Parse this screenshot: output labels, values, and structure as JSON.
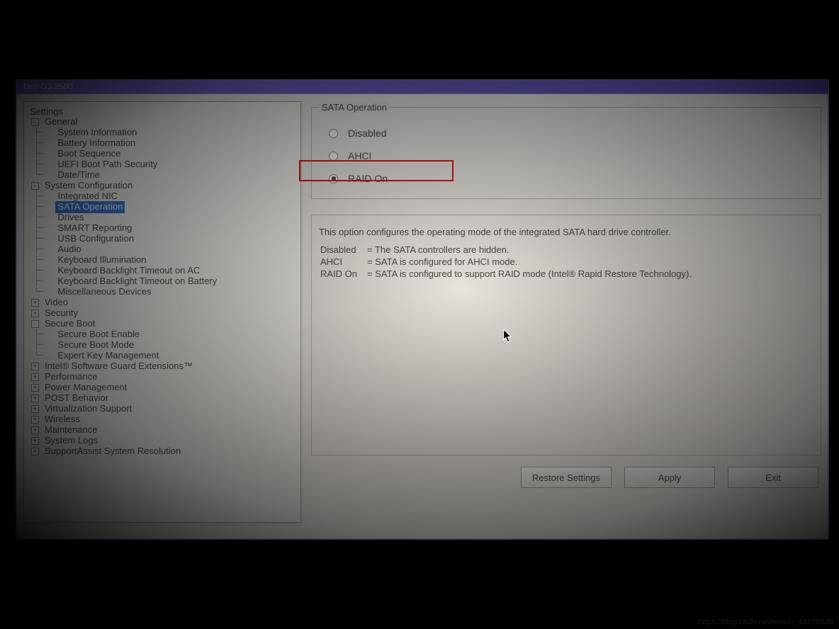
{
  "window": {
    "title": "Dell G3 3590"
  },
  "tree": {
    "heading": "Settings",
    "nodes": [
      {
        "label": "General",
        "type": "branch",
        "toggle": "-",
        "depth": 0
      },
      {
        "label": "System Information",
        "type": "leaf",
        "depth": 1
      },
      {
        "label": "Battery Information",
        "type": "leaf",
        "depth": 1
      },
      {
        "label": "Boot Sequence",
        "type": "leaf",
        "depth": 1
      },
      {
        "label": "UEFI Boot Path Security",
        "type": "leaf",
        "depth": 1
      },
      {
        "label": "Date/Time",
        "type": "leaf",
        "depth": 1,
        "last": true
      },
      {
        "label": "System Configuration",
        "type": "branch",
        "toggle": "-",
        "depth": 0
      },
      {
        "label": "Integrated NIC",
        "type": "leaf",
        "depth": 1
      },
      {
        "label": "SATA Operation",
        "type": "leaf",
        "depth": 1,
        "selected": true
      },
      {
        "label": "Drives",
        "type": "leaf",
        "depth": 1
      },
      {
        "label": "SMART Reporting",
        "type": "leaf",
        "depth": 1
      },
      {
        "label": "USB Configuration",
        "type": "leaf",
        "depth": 1
      },
      {
        "label": "Audio",
        "type": "leaf",
        "depth": 1
      },
      {
        "label": "Keyboard Illumination",
        "type": "leaf",
        "depth": 1
      },
      {
        "label": "Keyboard Backlight Timeout on AC",
        "type": "leaf",
        "depth": 1
      },
      {
        "label": "Keyboard Backlight Timeout on Battery",
        "type": "leaf",
        "depth": 1
      },
      {
        "label": "Miscellaneous Devices",
        "type": "leaf",
        "depth": 1,
        "last": true
      },
      {
        "label": "Video",
        "type": "branch",
        "toggle": "+",
        "depth": 0
      },
      {
        "label": "Security",
        "type": "branch",
        "toggle": "+",
        "depth": 0
      },
      {
        "label": "Secure Boot",
        "type": "branch",
        "toggle": "-",
        "depth": 0
      },
      {
        "label": "Secure Boot Enable",
        "type": "leaf",
        "depth": 1
      },
      {
        "label": "Secure Boot Mode",
        "type": "leaf",
        "depth": 1
      },
      {
        "label": "Expert Key Management",
        "type": "leaf",
        "depth": 1,
        "last": true
      },
      {
        "label": "Intel® Software Guard Extensions™",
        "type": "branch",
        "toggle": "+",
        "depth": 0
      },
      {
        "label": "Performance",
        "type": "branch",
        "toggle": "+",
        "depth": 0
      },
      {
        "label": "Power Management",
        "type": "branch",
        "toggle": "+",
        "depth": 0
      },
      {
        "label": "POST Behavior",
        "type": "branch",
        "toggle": "+",
        "depth": 0
      },
      {
        "label": "Virtualization Support",
        "type": "branch",
        "toggle": "+",
        "depth": 0
      },
      {
        "label": "Wireless",
        "type": "branch",
        "toggle": "+",
        "depth": 0
      },
      {
        "label": "Maintenance",
        "type": "branch",
        "toggle": "+",
        "depth": 0
      },
      {
        "label": "System Logs",
        "type": "branch",
        "toggle": "+",
        "depth": 0
      },
      {
        "label": "SupportAssist System Resolution",
        "type": "branch",
        "toggle": "+",
        "depth": 0
      }
    ]
  },
  "panel": {
    "legend": "SATA Operation",
    "options": [
      {
        "label": "Disabled",
        "selected": false
      },
      {
        "label": "AHCI",
        "selected": false
      },
      {
        "label": "RAID On",
        "selected": true,
        "highlighted": true
      }
    ],
    "description_intro": "This option configures the operating mode of the integrated SATA hard drive controller.",
    "description_rows": [
      {
        "k": "Disabled",
        "v": "= The SATA controllers are hidden."
      },
      {
        "k": "AHCI",
        "v": "= SATA is configured for AHCI mode."
      },
      {
        "k": "RAID On",
        "v": "= SATA is configured to support RAID mode (Intel® Rapid Restore Technology)."
      }
    ]
  },
  "buttons": {
    "restore": "Restore Settings",
    "apply": "Apply",
    "exit": "Exit"
  },
  "watermark": "https://blog.csdn.net/weixin_48178539"
}
